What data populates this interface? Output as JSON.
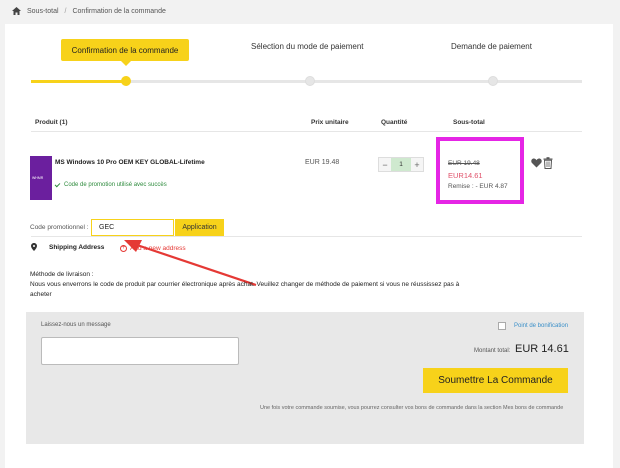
{
  "breadcrumb": {
    "home_icon": "home-icon",
    "item1": "Sous-total",
    "separator": "/",
    "item2": "Confirmation de la commande"
  },
  "steps": {
    "step1": "Confirmation de la commande",
    "step2": "Sélection du mode de paiement",
    "step3": "Demande de paiement",
    "active_index": 0
  },
  "table": {
    "col_product": "Produit (1)",
    "col_unit_price": "Prix unitaire",
    "col_quantity": "Quantité",
    "col_subtotal": "Sous-total"
  },
  "product": {
    "image_text": "WHMR",
    "name": "MS Windows 10 Pro OEM KEY GLOBAL-Lifetime",
    "promo_status": "Code de promotion utilisé avec succès",
    "unit_price": "EUR 19.48",
    "qty_minus": "−",
    "quantity": "1",
    "qty_plus": "+",
    "old_price": "EUR 19.48",
    "new_price": "EUR14.61",
    "discount": "Remise : - EUR 4.87"
  },
  "promo": {
    "label": "Code promotionnel :",
    "value": "GEC",
    "apply_label": "Application"
  },
  "shipping": {
    "label": "Shipping Address",
    "add_label": "Add a new address",
    "add_icon": "+"
  },
  "delivery": {
    "title": "Méthode de livraison :",
    "text": "Nous vous enverrons le code de produit par courrier électronique après achat. Veuillez changer de méthode de paiement si vous ne réussissez pas à acheter"
  },
  "order": {
    "message_label": "Laissez-nous un message",
    "message_value": "",
    "points_label": "Point de bonification",
    "total_label": "Montant total:",
    "total_value": "EUR 14.61",
    "submit_label": "Soumettre La Commande",
    "note": "Une fois votre commande soumise, vous pourrez consulter vos bons de commande dans la section Mes bons de commande"
  },
  "colors": {
    "accent": "#f7d21a",
    "highlight_box": "#e525e5",
    "annotation_arrow": "#e53935",
    "success": "#2e8b3d",
    "discount_price": "#e0526b"
  }
}
